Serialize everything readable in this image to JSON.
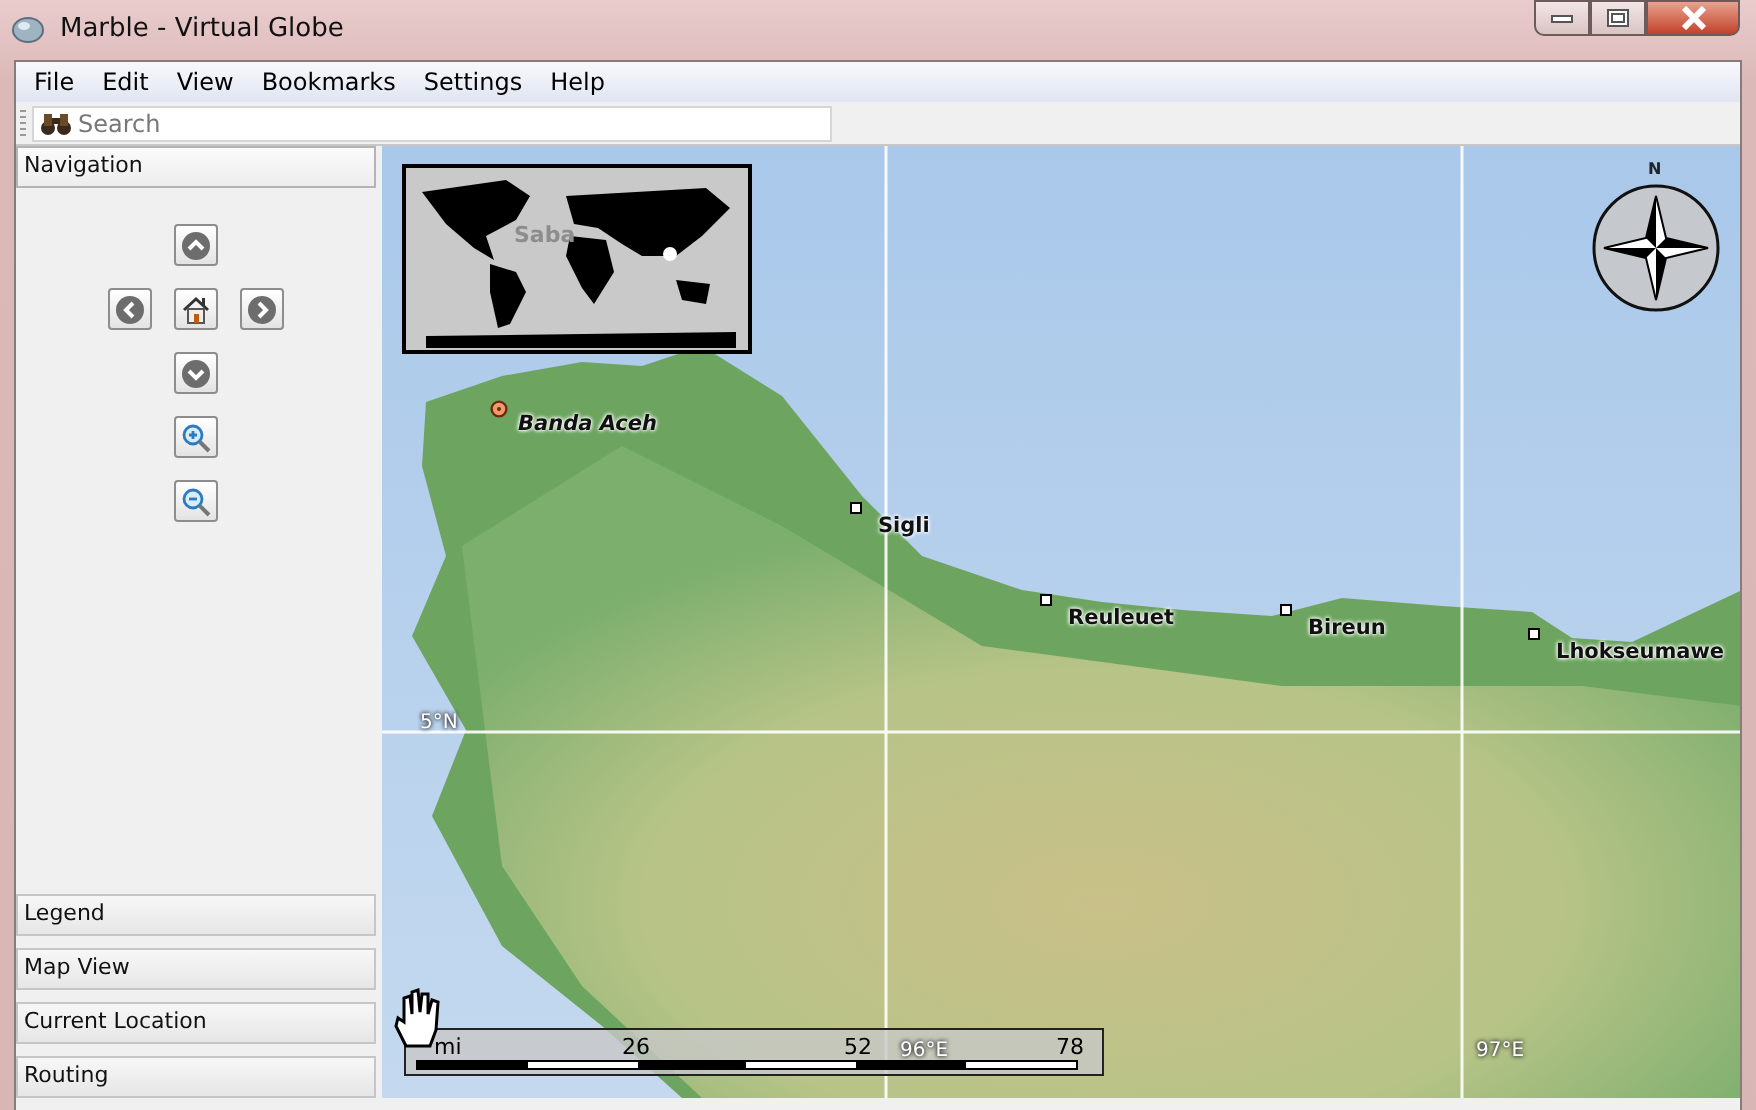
{
  "window": {
    "title": "Marble - Virtual Globe"
  },
  "menu": [
    "File",
    "Edit",
    "View",
    "Bookmarks",
    "Settings",
    "Help"
  ],
  "search": {
    "placeholder": "Search"
  },
  "panels": [
    {
      "title": "Navigation",
      "expanded": true
    },
    {
      "title": "Legend",
      "expanded": false
    },
    {
      "title": "Map View",
      "expanded": false
    },
    {
      "title": "Current Location",
      "expanded": false
    },
    {
      "title": "Routing",
      "expanded": false
    }
  ],
  "map": {
    "overview_label": "Saba",
    "grid_labels": [
      "5°N",
      "96°E",
      "97°E"
    ],
    "places": [
      {
        "name": "Banda Aceh",
        "kind": "capital"
      },
      {
        "name": "Sigli",
        "kind": "town"
      },
      {
        "name": "Reuleuet",
        "kind": "town"
      },
      {
        "name": "Bireun",
        "kind": "town"
      },
      {
        "name": "Lhokseumawe",
        "kind": "town"
      }
    ],
    "compass": {
      "label": "N"
    },
    "scale": {
      "labels": [
        "mi",
        "26",
        "52",
        "78"
      ]
    }
  }
}
